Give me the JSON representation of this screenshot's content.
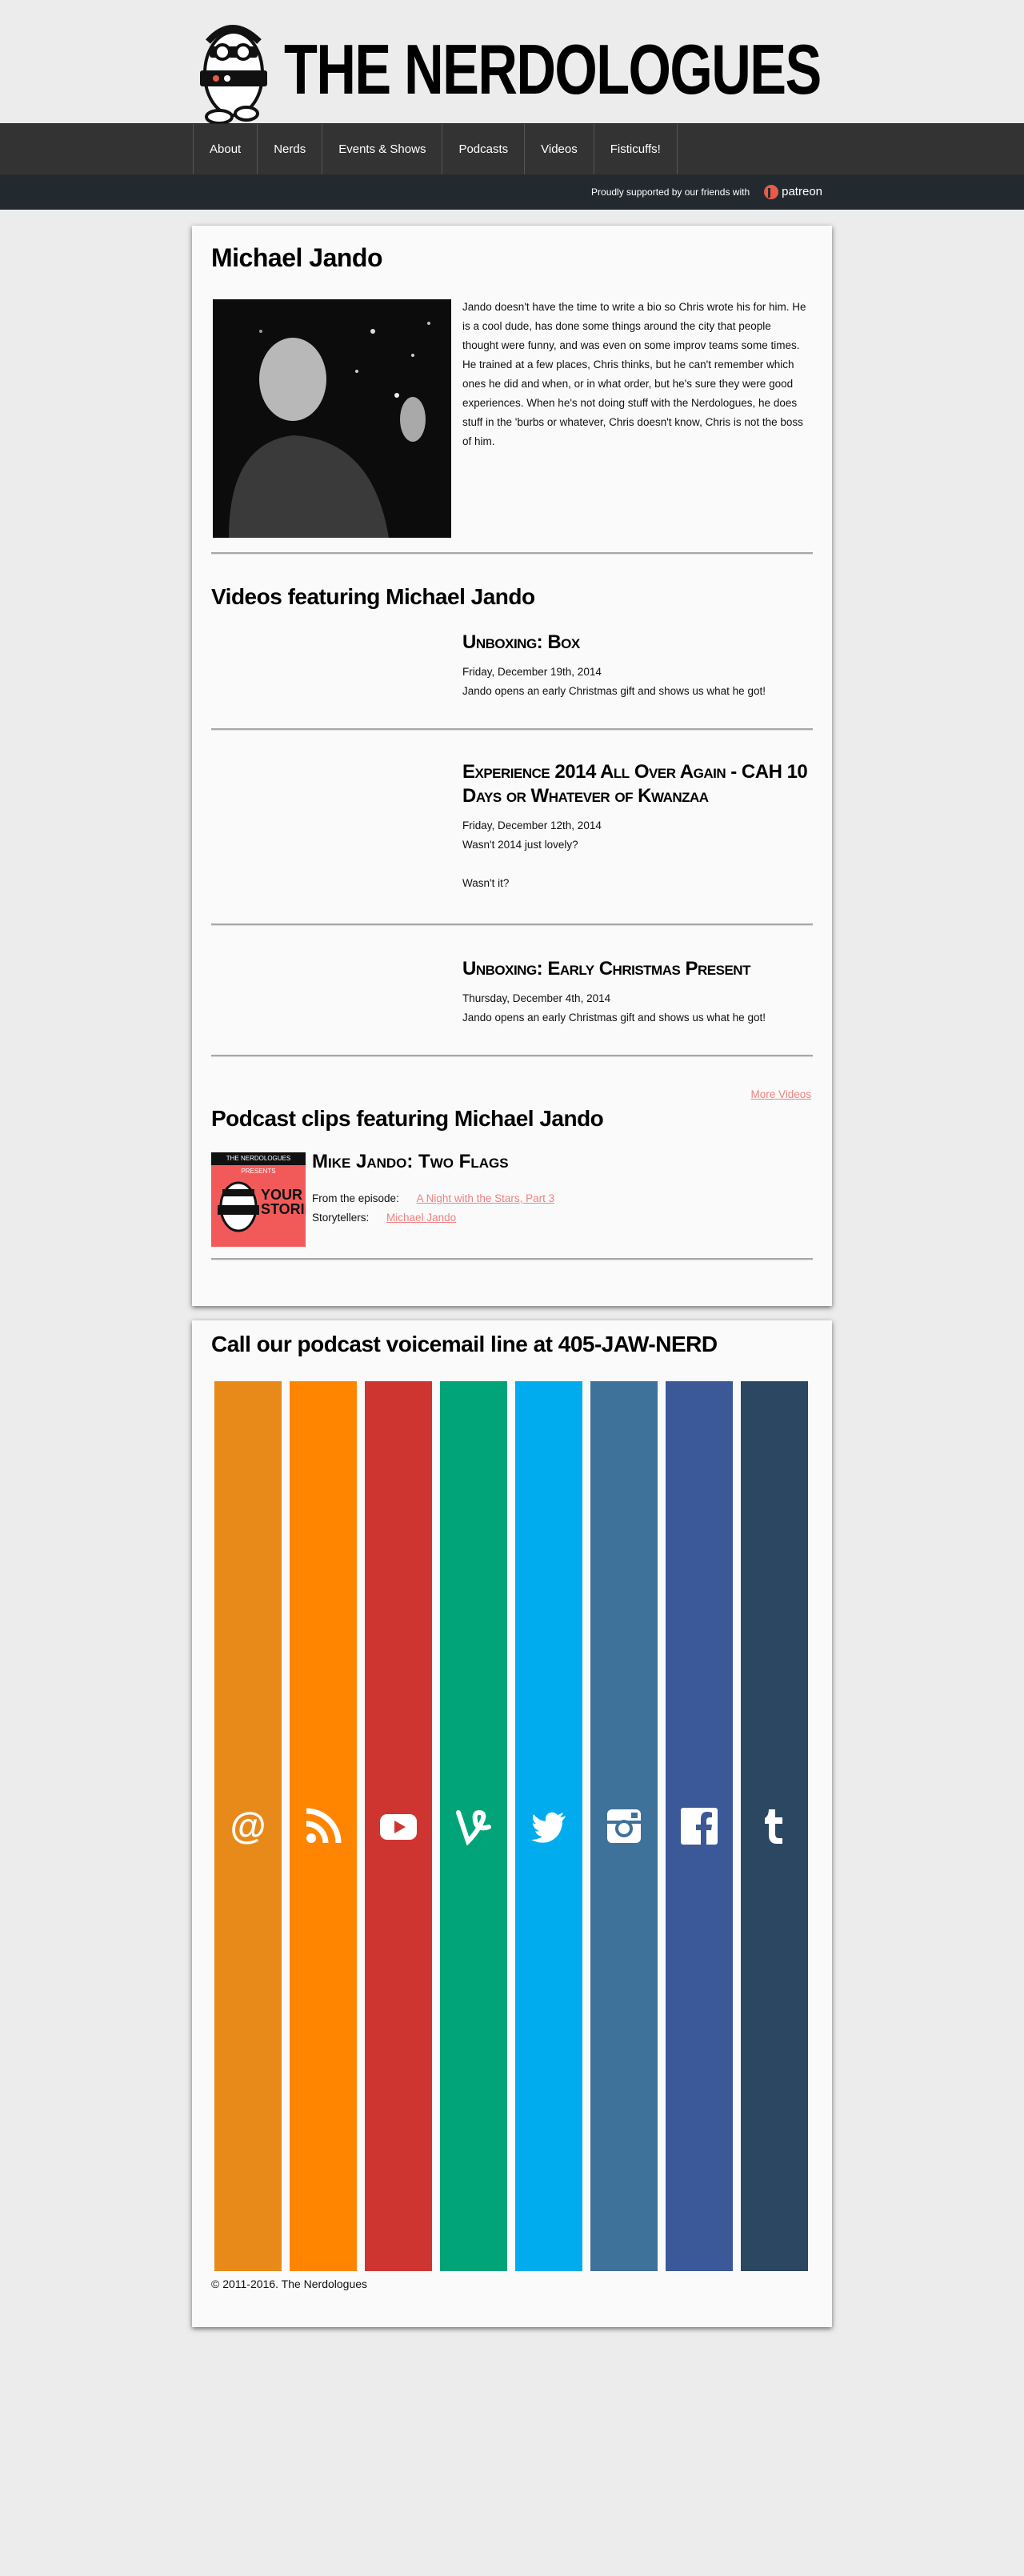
{
  "site": {
    "title": "THE NERDOLOGUES"
  },
  "nav": {
    "items": [
      "About",
      "Nerds",
      "Events & Shows",
      "Podcasts",
      "Videos",
      "Fisticuffs!"
    ]
  },
  "sponsor": {
    "text": "Proudly supported by our friends with",
    "brand": "patreon"
  },
  "profile": {
    "name": "Michael Jando",
    "bio": "Jando doesn't have the time to write a bio so Chris wrote his for him. He is a cool dude, has done some things around the city that people thought were funny, and was even on some improv teams some times. He trained at a few places, Chris thinks, but he can't remember which ones he did and when, or in what order, but he's sure they were good experiences. When he's not doing stuff with the Nerdologues, he does stuff in the 'burbs or whatever, Chris doesn't know, Chris is not the boss of him."
  },
  "videos": {
    "heading": "Videos featuring Michael Jando",
    "items": [
      {
        "title": "Unboxing: Box",
        "date": "Friday, December 19th, 2014",
        "desc": "Jando opens an early Christmas gift and shows us what he got!"
      },
      {
        "title": "Experience 2014 All Over Again - CAH 10 Days or Whatever of Kwanzaa",
        "date": "Friday, December 12th, 2014",
        "desc": "Wasn't 2014 just lovely?",
        "desc2": "Wasn't it?"
      },
      {
        "title": "Unboxing: Early Christmas Present",
        "date": "Thursday, December 4th, 2014",
        "desc": "Jando opens an early Christmas gift and shows us what he got!"
      }
    ],
    "more_label": "More Videos"
  },
  "podcasts": {
    "heading": "Podcast clips featuring Michael Jando",
    "thumb_top": "THE NERDOLOGUES PRESENTS",
    "thumb_title": "YOUR STORIES",
    "items": [
      {
        "title": "Mike Jando: Two Flags",
        "episode_label": "From the episode:",
        "episode": "A Night with the Stars, Part 3",
        "tellers_label": "Storytellers:",
        "tellers": "Michael Jando"
      }
    ]
  },
  "footer": {
    "voicemail": "Call our podcast voicemail line at 405-JAW-NERD",
    "social": [
      {
        "name": "email-icon",
        "color": "#e88a1a"
      },
      {
        "name": "rss-icon",
        "color": "#ff8500"
      },
      {
        "name": "youtube-icon",
        "color": "#cf3530"
      },
      {
        "name": "vine-icon",
        "color": "#00a478"
      },
      {
        "name": "twitter-icon",
        "color": "#00acee"
      },
      {
        "name": "instagram-icon",
        "color": "#3f729b"
      },
      {
        "name": "facebook-icon",
        "color": "#3b5998"
      },
      {
        "name": "tumblr-icon",
        "color": "#2c4762"
      }
    ],
    "copyright": "© 2011-2016. The Nerdologues"
  }
}
